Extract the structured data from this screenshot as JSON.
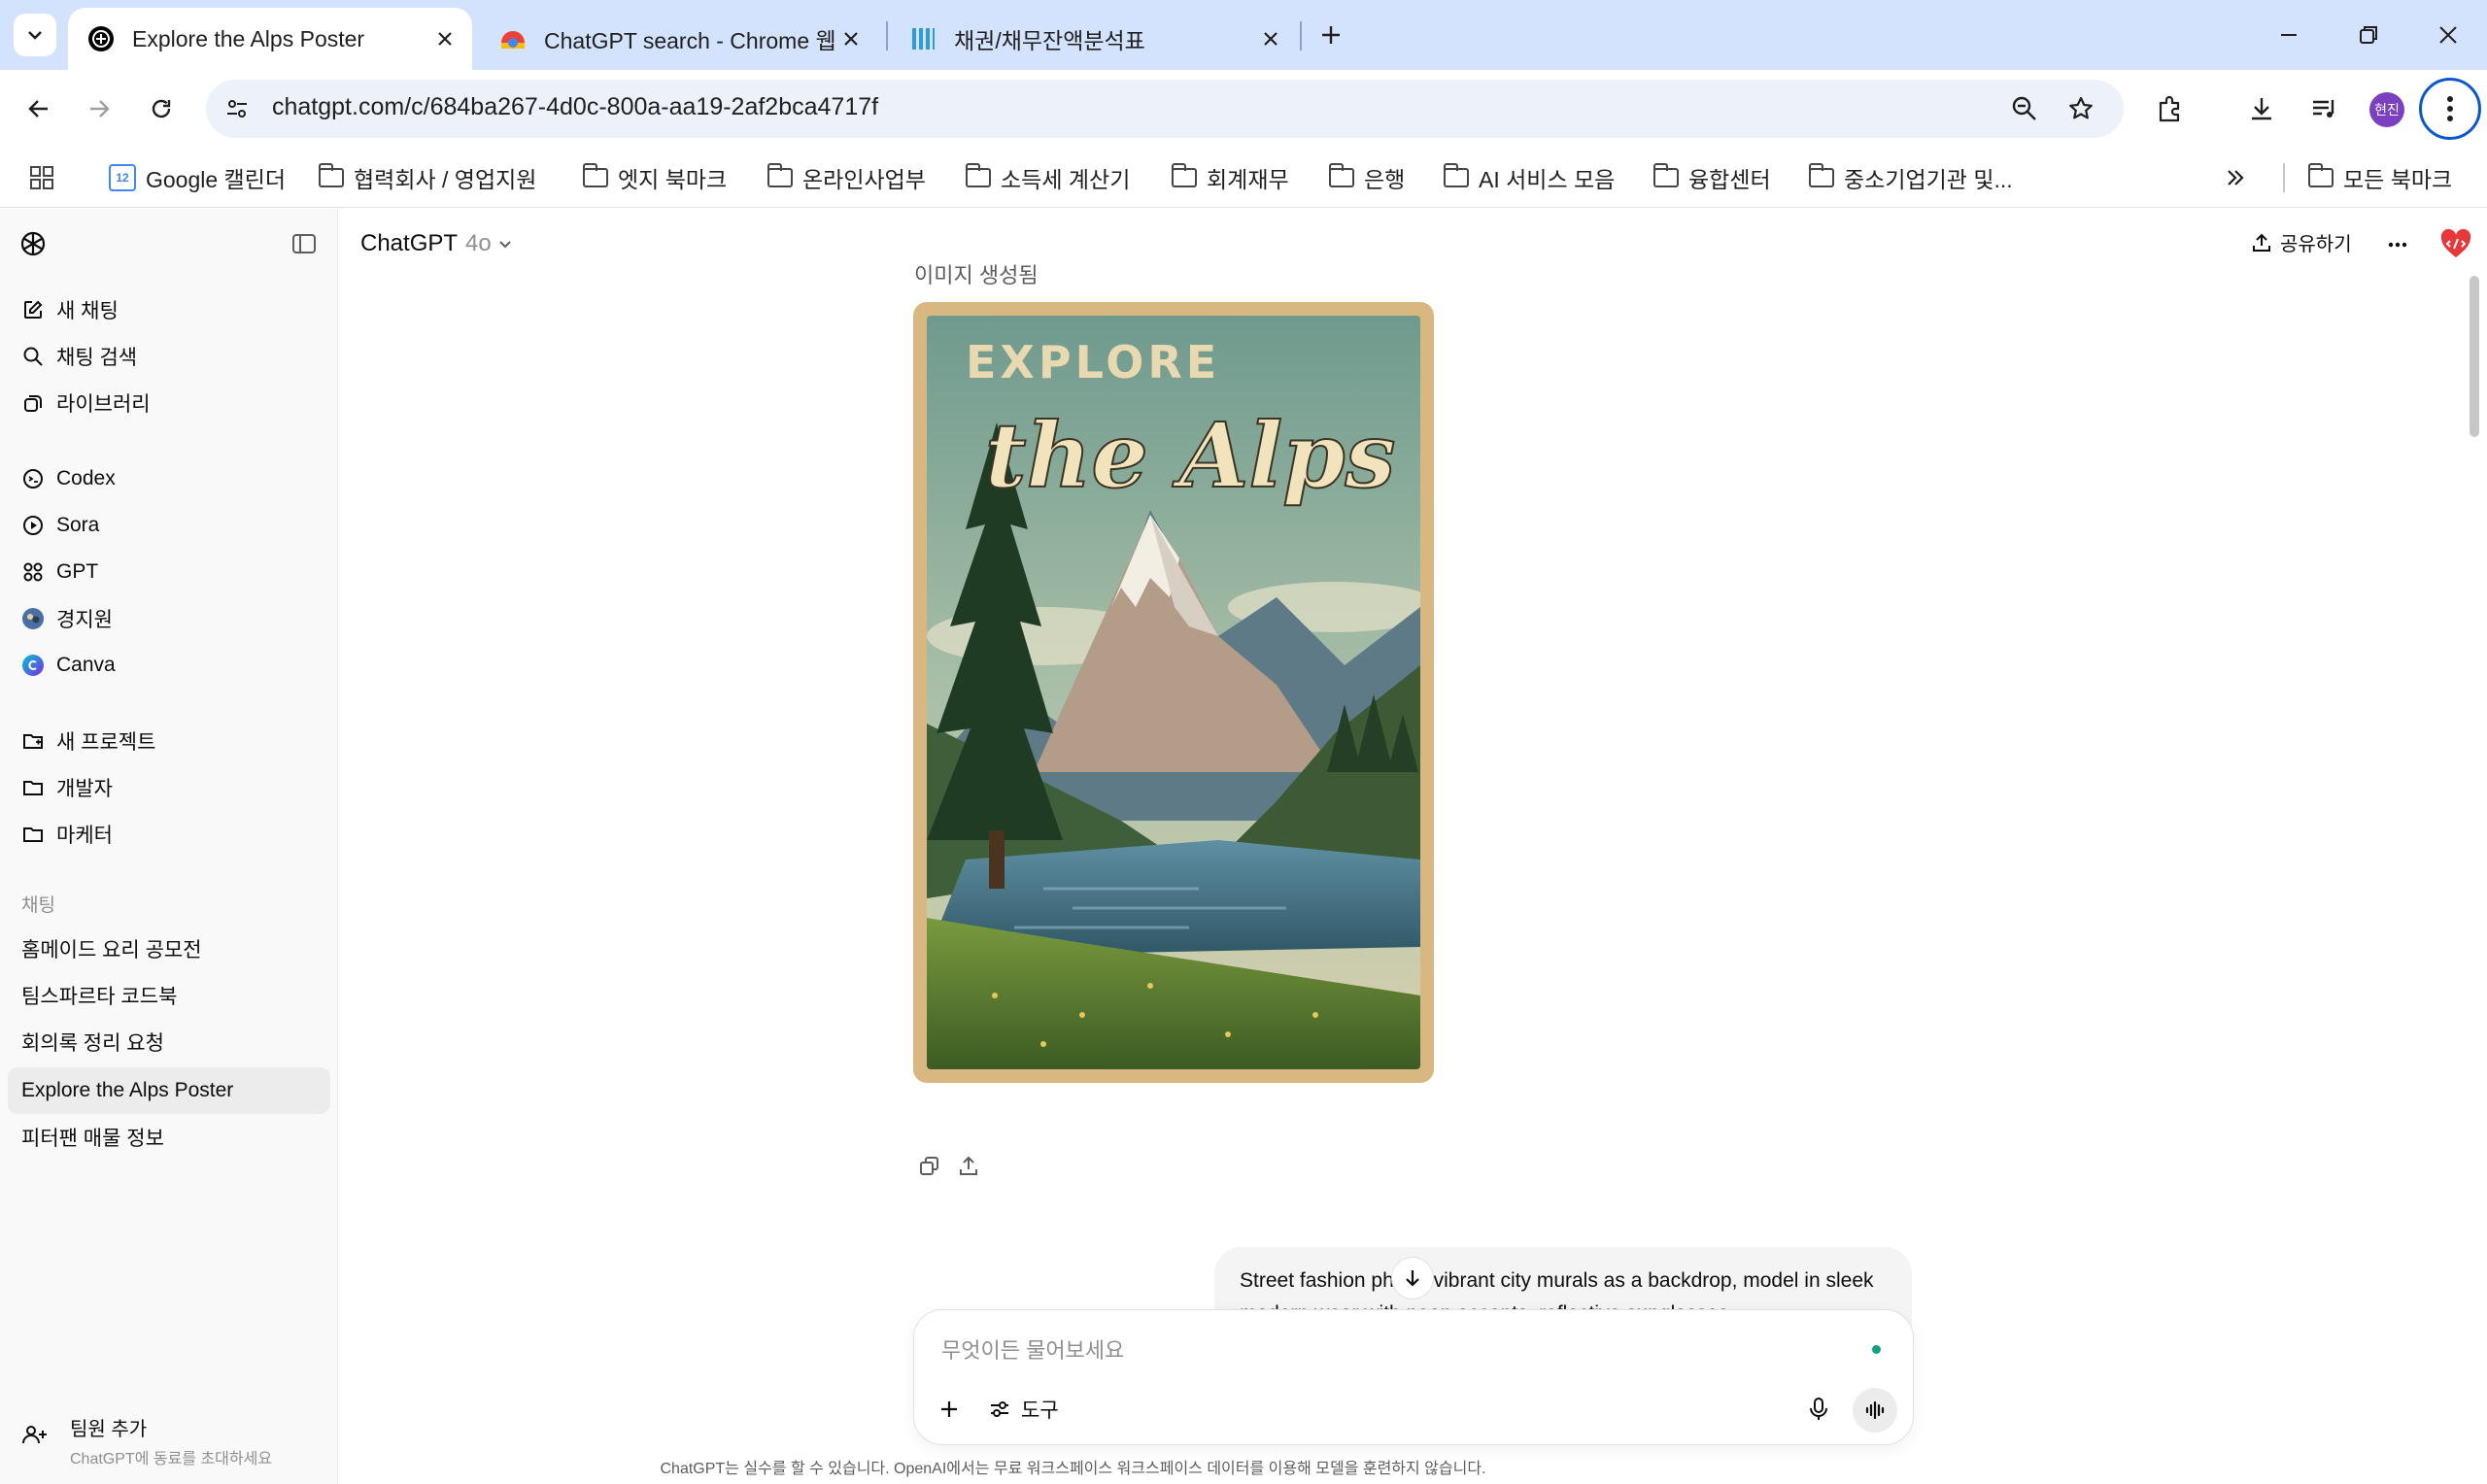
{
  "browser": {
    "tabs": [
      {
        "title": "Explore the Alps Poster",
        "active": true
      },
      {
        "title": "ChatGPT search - Chrome 웹 스토어",
        "active": false
      },
      {
        "title": "채권/채무잔액분석표",
        "active": false
      }
    ],
    "url": "chatgpt.com/c/684ba267-4d0c-800a-aa19-2af2bca4717f",
    "profile_initials": "현진",
    "bookmarks": [
      {
        "label": "Google 캘린더",
        "icon": "calendar-icon"
      },
      {
        "label": "협력회사 / 영업지원",
        "icon": "folder-icon"
      },
      {
        "label": "엣지 북마크",
        "icon": "folder-icon"
      },
      {
        "label": "온라인사업부",
        "icon": "folder-icon"
      },
      {
        "label": "소득세 계산기",
        "icon": "folder-icon"
      },
      {
        "label": "회계재무",
        "icon": "folder-icon"
      },
      {
        "label": "은행",
        "icon": "folder-icon"
      },
      {
        "label": "AI 서비스 모음",
        "icon": "folder-icon"
      },
      {
        "label": "융합센터",
        "icon": "folder-icon"
      },
      {
        "label": "중소기업기관 및...",
        "icon": "folder-icon"
      }
    ],
    "all_bookmarks_label": "모든 북마크",
    "calendar_icon_text": "12"
  },
  "sidebar": {
    "top_items": [
      {
        "label": "새 채팅",
        "icon": "new-chat-icon"
      },
      {
        "label": "채팅 검색",
        "icon": "search-icon"
      },
      {
        "label": "라이브러리",
        "icon": "library-icon"
      }
    ],
    "apps": [
      {
        "label": "Codex",
        "icon": "codex-icon"
      },
      {
        "label": "Sora",
        "icon": "sora-icon"
      },
      {
        "label": "GPT",
        "icon": "gpt-grid-icon"
      },
      {
        "label": "경지원",
        "icon": "custom-gpt-avatar-icon"
      },
      {
        "label": "Canva",
        "icon": "canva-icon"
      }
    ],
    "projects": [
      {
        "label": "새 프로젝트",
        "icon": "new-project-icon"
      },
      {
        "label": "개발자",
        "icon": "folder-icon"
      },
      {
        "label": "마케터",
        "icon": "folder-icon"
      }
    ],
    "chats_section_label": "채팅",
    "chats": [
      {
        "label": "홈메이드 요리 공모전",
        "selected": false
      },
      {
        "label": "팀스파르타 코드북",
        "selected": false
      },
      {
        "label": "회의록 정리 요청",
        "selected": false
      },
      {
        "label": "Explore the Alps Poster",
        "selected": true
      },
      {
        "label": "피터팬 매물 정보",
        "selected": false
      }
    ],
    "invite": {
      "title": "팀원 추가",
      "subtitle": "ChatGPT에 동료를 초대하세요"
    }
  },
  "header": {
    "model_name": "ChatGPT",
    "model_version": "4o",
    "share_label": "공유하기"
  },
  "conversation": {
    "image_caption": "이미지 생성됨",
    "poster_line1": "EXPLORE",
    "poster_line2": "the Alps",
    "user_message": "Street fashion photo, vibrant city murals as a backdrop, model in sleek modern wear with neon accents, reflective sunglasses"
  },
  "composer": {
    "placeholder": "무엇이든 물어보세요",
    "tools_label": "도구"
  },
  "disclaimer": "ChatGPT는 실수를 할 수 있습니다. OpenAI에서는 무료 워크스페이스 워크스페이스 데이터를 이용해 모델을 훈련하지 않습니다.",
  "colors": {
    "tabstrip": "#d3e3fd",
    "omnibox": "#edf2fa",
    "sidebar": "#f9f9f9",
    "accent_green": "#10a37f",
    "profile": "#7b3fbf"
  }
}
